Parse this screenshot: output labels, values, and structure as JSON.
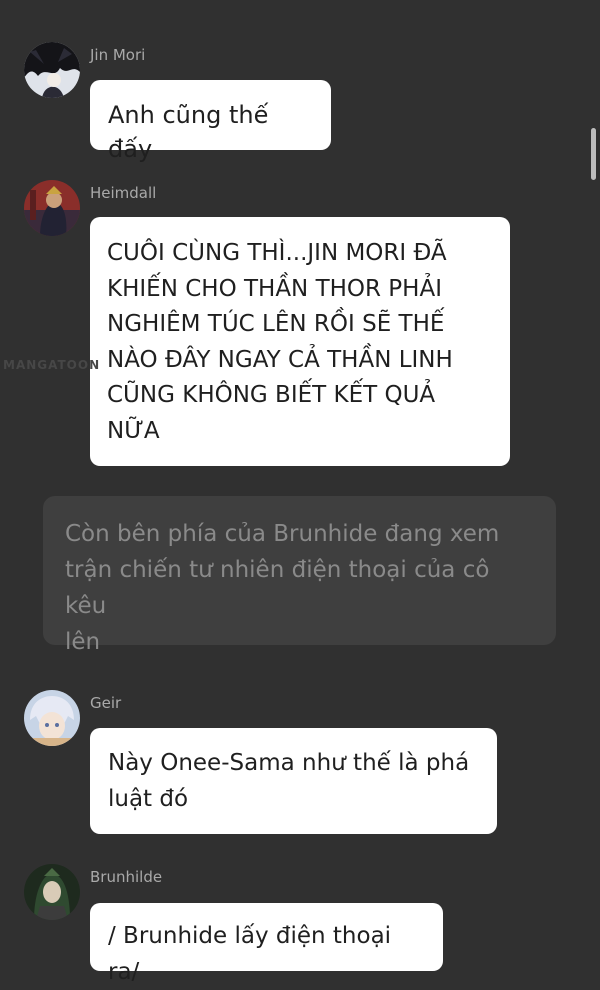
{
  "watermark": "MANGATOON",
  "messages": [
    {
      "username": "Jin Mori",
      "avatar_icon": "avatar-jin-mori-icon",
      "text": "Anh cũng thế đấy"
    },
    {
      "username": "Heimdall",
      "avatar_icon": "avatar-heimdall-icon",
      "text": "CUÔI CÙNG THÌ...JIN MORI ĐÃ\nKHIẾN CHO THẦN THOR PHẢI\nNGHIÊM TÚC LÊN RỒI SẼ THẾ\nNÀO ĐÂY NGAY CẢ THẦN LINH\nCŨNG KHÔNG BIẾT KẾT QUẢ\nNỮA"
    },
    {
      "username": "Geir",
      "avatar_icon": "avatar-geir-icon",
      "text": "Này Onee-Sama như thế là phá\nluật đó"
    },
    {
      "username": "Brunhilde",
      "avatar_icon": "avatar-brunhilde-icon",
      "text": "/ Brunhide lấy điện thoại ra/"
    }
  ],
  "narration": "Còn bên phía của Brunhide đang xem\ntrận chiến tư nhiên điện thoại của cô kêu\nlên",
  "colors": {
    "background": "#303030",
    "bubble": "#ffffff",
    "narration_bg": "#3f3f3f",
    "narration_text": "#8a8a8a",
    "username_text": "#a9a9a9"
  }
}
